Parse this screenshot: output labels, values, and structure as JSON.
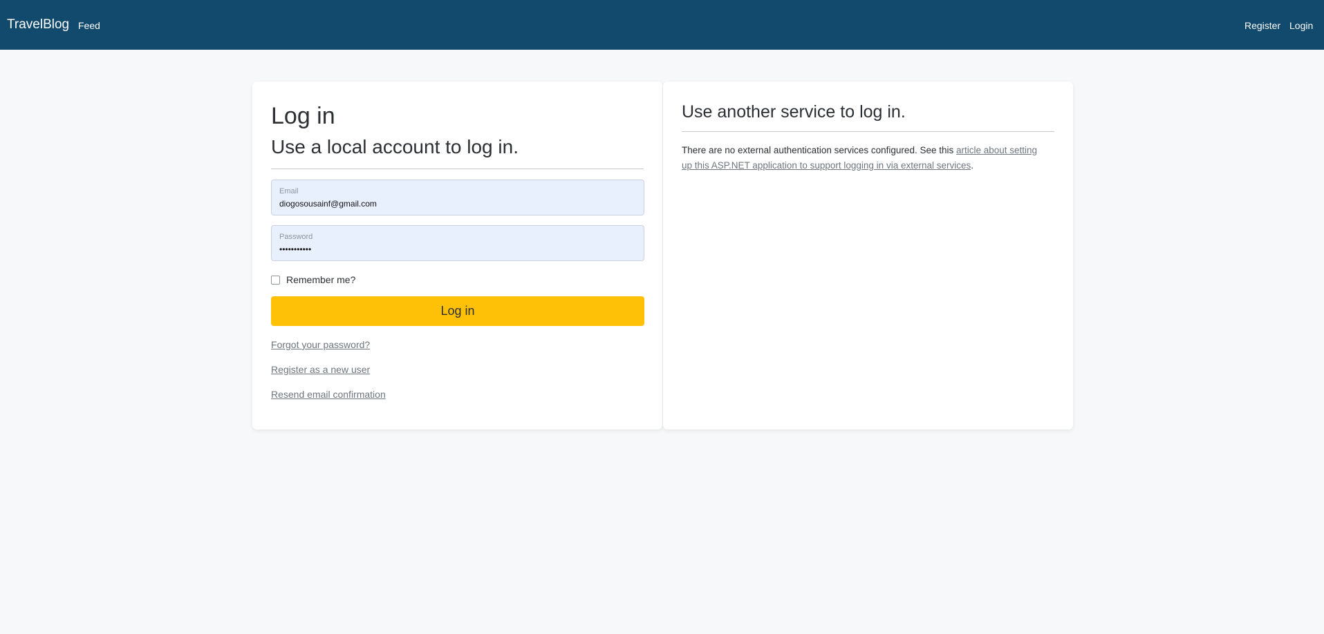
{
  "navbar": {
    "brand": "TravelBlog",
    "links": {
      "feed": "Feed",
      "register": "Register",
      "login": "Login"
    },
    "background": "#124a6d"
  },
  "login_form": {
    "title": "Log in",
    "subtitle": "Use a local account to log in.",
    "email": {
      "label": "Email",
      "value": "diogosousainf@gmail.com"
    },
    "password": {
      "label": "Password",
      "value": "•••••••••••"
    },
    "remember_label": "Remember me?",
    "remember_checked": false,
    "submit_label": "Log in",
    "submit_color": "#ffc107",
    "links": {
      "forgot": "Forgot your password?",
      "register": "Register as a new user",
      "resend": "Resend email confirmation"
    }
  },
  "external": {
    "title": "Use another service to log in.",
    "text_before": "There are no external authentication services configured. See this ",
    "link_text": "article about setting up this ASP.NET application to support logging in via external services",
    "text_after": "."
  }
}
